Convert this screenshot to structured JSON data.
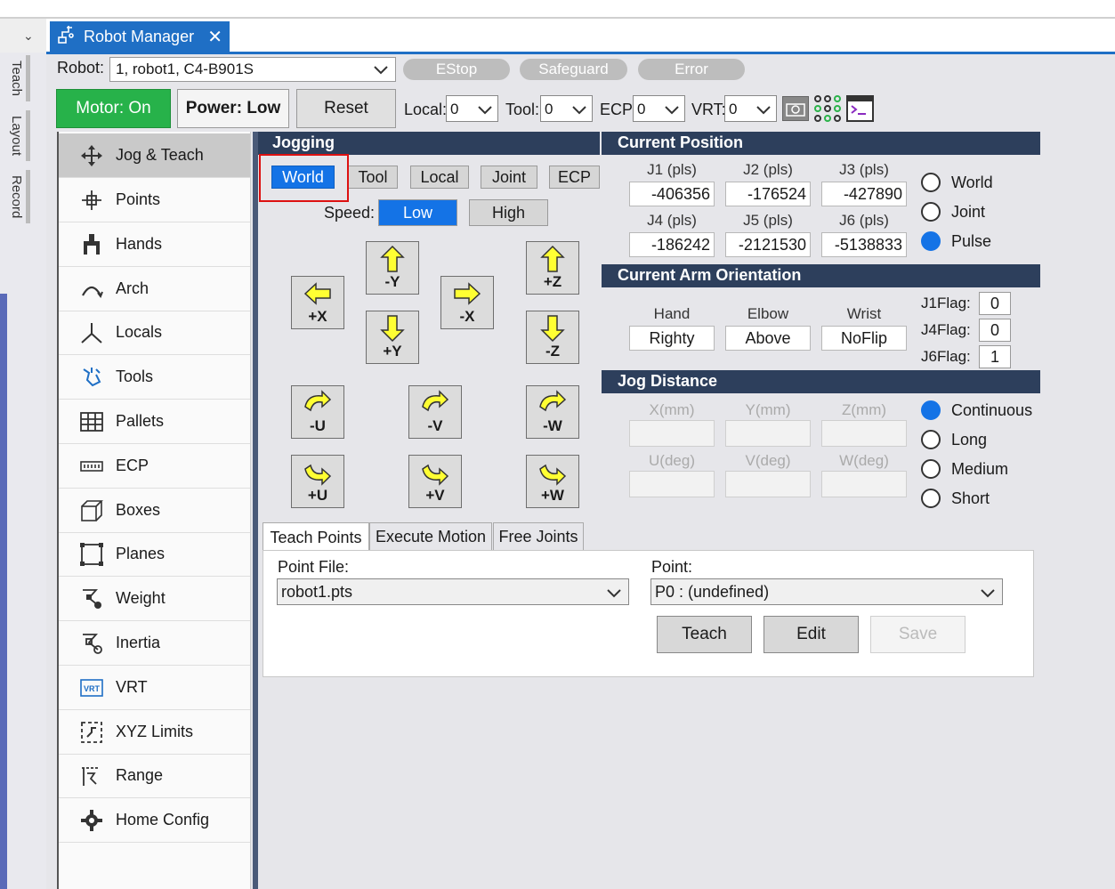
{
  "tab": {
    "title": "Robot Manager",
    "close": "✕"
  },
  "side_tabs": [
    "Teach",
    "Layout",
    "Record"
  ],
  "toolbar": {
    "robot_label": "Robot:",
    "robot_value": "1, robot1, C4-B901S",
    "estop": "EStop",
    "safeguard": "Safeguard",
    "error": "Error",
    "motor": "Motor: On",
    "power": "Power: Low",
    "reset": "Reset",
    "local_label": "Local:",
    "local_value": "0",
    "tool_label": "Tool:",
    "tool_value": "0",
    "ecp_label": "ECP:",
    "ecp_value": "0",
    "vrt_label": "VRT:",
    "vrt_value": "0"
  },
  "sidebar": {
    "items": [
      {
        "label": "Jog & Teach",
        "icon": "move-icon"
      },
      {
        "label": "Points",
        "icon": "points-icon"
      },
      {
        "label": "Hands",
        "icon": "hand-icon"
      },
      {
        "label": "Arch",
        "icon": "arch-icon"
      },
      {
        "label": "Locals",
        "icon": "locals-icon"
      },
      {
        "label": "Tools",
        "icon": "tools-icon"
      },
      {
        "label": "Pallets",
        "icon": "pallet-icon"
      },
      {
        "label": "ECP",
        "icon": "ecp-icon"
      },
      {
        "label": "Boxes",
        "icon": "box-icon"
      },
      {
        "label": "Planes",
        "icon": "plane-icon"
      },
      {
        "label": "Weight",
        "icon": "weight-icon"
      },
      {
        "label": "Inertia",
        "icon": "inertia-icon"
      },
      {
        "label": "VRT",
        "icon": "vrt-icon"
      },
      {
        "label": "XYZ Limits",
        "icon": "xyz-limits-icon"
      },
      {
        "label": "Range",
        "icon": "range-icon"
      },
      {
        "label": "Home Config",
        "icon": "home-config-icon"
      }
    ]
  },
  "jogging": {
    "header": "Jogging",
    "modes": [
      "World",
      "Tool",
      "Local",
      "Joint",
      "ECP"
    ],
    "speed_label": "Speed:",
    "speeds": [
      "Low",
      "High"
    ],
    "buttons": {
      "px": "+X",
      "my": "-Y",
      "mx": "-X",
      "pz": "+Z",
      "py": "+Y",
      "mz": "-Z",
      "mu": "-U",
      "mv": "-V",
      "mw": "-W",
      "pu": "+U",
      "pv": "+V",
      "pw": "+W"
    }
  },
  "position": {
    "header": "Current Position",
    "labels": [
      "J1 (pls)",
      "J2 (pls)",
      "J3 (pls)",
      "J4 (pls)",
      "J5 (pls)",
      "J6 (pls)"
    ],
    "values": [
      "-406356",
      "-176524",
      "-427890",
      "-186242",
      "-2121530",
      "-5138833"
    ],
    "modes": [
      "World",
      "Joint",
      "Pulse"
    ]
  },
  "arm": {
    "header": "Current Arm Orientation",
    "labels": [
      "Hand",
      "Elbow",
      "Wrist"
    ],
    "values": [
      "Righty",
      "Above",
      "NoFlip"
    ],
    "flag_labels": [
      "J1Flag:",
      "J4Flag:",
      "J6Flag:"
    ],
    "flag_values": [
      "0",
      "0",
      "1"
    ]
  },
  "distance": {
    "header": "Jog Distance",
    "labels": [
      "X(mm)",
      "Y(mm)",
      "Z(mm)",
      "U(deg)",
      "V(deg)",
      "W(deg)"
    ],
    "modes": [
      "Continuous",
      "Long",
      "Medium",
      "Short"
    ]
  },
  "bottom": {
    "tabs": [
      "Teach Points",
      "Execute Motion",
      "Free Joints"
    ],
    "point_file_label": "Point File:",
    "point_file_value": "robot1.pts",
    "point_label": "Point:",
    "point_value": "P0 : (undefined)",
    "teach": "Teach",
    "edit": "Edit",
    "save": "Save"
  }
}
